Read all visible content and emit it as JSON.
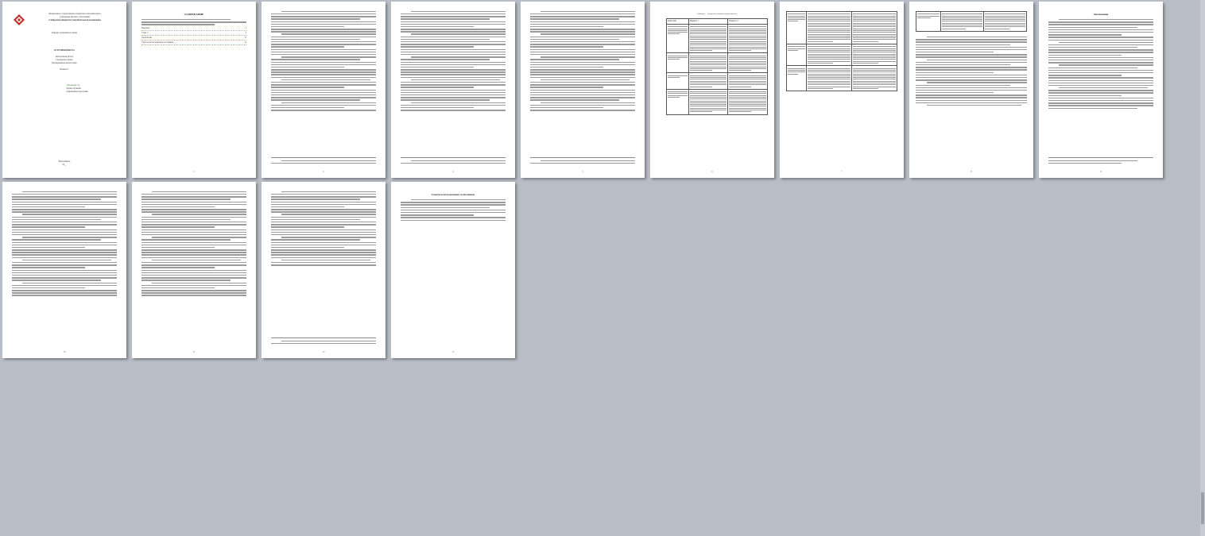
{
  "title_page": {
    "ministry_lines": [
      "Федеральное государственное бюджетное образовательное",
      "учреждение высшего образования",
      "«Сибирский университет потребительской кооперации»"
    ],
    "department": "Кафедра гражданского права",
    "work_type": "КУРСОВАЯ РАБОТА",
    "discipline_lines": [
      "Контрольная работа",
      "Гражданское право",
      "Предпринимательское право"
    ],
    "variant": "Вариант 1",
    "student_lines": [
      "Обучающегося",
      "форма обучения",
      "направление подготовки"
    ],
    "city_year": "Новосибирск",
    "year": "20__"
  },
  "toc": {
    "heading": "СОДЕРЖАНИЕ",
    "items": [
      {
        "label": "Введение",
        "page": "3"
      },
      {
        "label": "Глава 1",
        "page": "5"
      },
      {
        "label": "Заключение",
        "page": "11"
      },
      {
        "label": "Список использованных источников",
        "page": "14"
      }
    ]
  },
  "table_page": {
    "caption": "Таблица 1 – Сравнение основных характеристик",
    "col_headers": [
      "Критерий",
      "Вариант 1",
      "Вариант 2"
    ]
  },
  "conclusion_page": {
    "heading": "Заключение"
  },
  "references_page": {
    "heading": "Список использованных источников"
  },
  "page_numbers": [
    "2",
    "3",
    "4",
    "5",
    "6",
    "7",
    "8",
    "9",
    "10",
    "11",
    "12",
    "13",
    "14"
  ],
  "colors": {
    "background": "#b9bec6",
    "page": "#ffffff",
    "logo": "#c0302a"
  }
}
